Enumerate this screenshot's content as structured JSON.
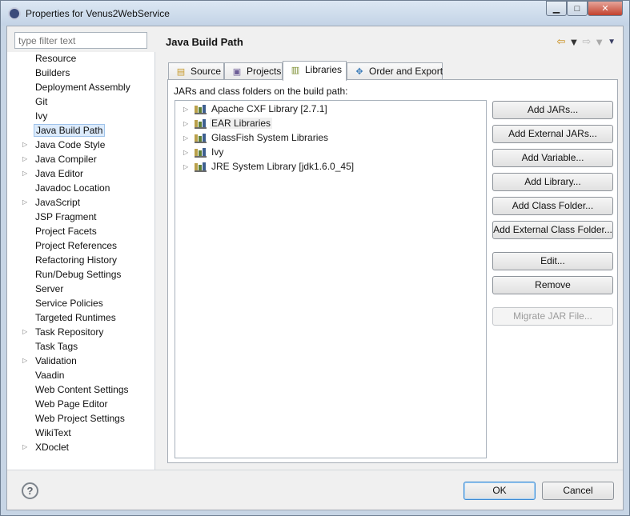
{
  "window": {
    "title": "Properties for Venus2WebService",
    "minimize": "▁",
    "maximize": "□",
    "close": "✕"
  },
  "filter": {
    "placeholder": "type filter text"
  },
  "nav": [
    {
      "label": "Resource",
      "expandable": false
    },
    {
      "label": "Builders",
      "expandable": false
    },
    {
      "label": "Deployment Assembly",
      "expandable": false
    },
    {
      "label": "Git",
      "expandable": false
    },
    {
      "label": "Ivy",
      "expandable": false
    },
    {
      "label": "Java Build Path",
      "expandable": false,
      "selected": true
    },
    {
      "label": "Java Code Style",
      "expandable": true
    },
    {
      "label": "Java Compiler",
      "expandable": true
    },
    {
      "label": "Java Editor",
      "expandable": true
    },
    {
      "label": "Javadoc Location",
      "expandable": false
    },
    {
      "label": "JavaScript",
      "expandable": true
    },
    {
      "label": "JSP Fragment",
      "expandable": false
    },
    {
      "label": "Project Facets",
      "expandable": false
    },
    {
      "label": "Project References",
      "expandable": false
    },
    {
      "label": "Refactoring History",
      "expandable": false
    },
    {
      "label": "Run/Debug Settings",
      "expandable": false
    },
    {
      "label": "Server",
      "expandable": false
    },
    {
      "label": "Service Policies",
      "expandable": false
    },
    {
      "label": "Targeted Runtimes",
      "expandable": false
    },
    {
      "label": "Task Repository",
      "expandable": true
    },
    {
      "label": "Task Tags",
      "expandable": false
    },
    {
      "label": "Validation",
      "expandable": true
    },
    {
      "label": "Vaadin",
      "expandable": false
    },
    {
      "label": "Web Content Settings",
      "expandable": false
    },
    {
      "label": "Web Page Editor",
      "expandable": false
    },
    {
      "label": "Web Project Settings",
      "expandable": false
    },
    {
      "label": "WikiText",
      "expandable": false
    },
    {
      "label": "XDoclet",
      "expandable": true
    }
  ],
  "page": {
    "title": "Java Build Path",
    "tabs": [
      {
        "label": "Source",
        "icon": "source-folder-icon"
      },
      {
        "label": "Projects",
        "icon": "projects-icon"
      },
      {
        "label": "Libraries",
        "icon": "libraries-icon",
        "active": true
      },
      {
        "label": "Order and Export",
        "icon": "order-export-icon"
      }
    ],
    "pane_label": "JARs and class folders on the build path:",
    "libraries": [
      {
        "label": "Apache CXF Library [2.7.1]"
      },
      {
        "label": "EAR Libraries",
        "highlighted": true
      },
      {
        "label": "GlassFish System Libraries"
      },
      {
        "label": "Ivy"
      },
      {
        "label": "JRE System Library [jdk1.6.0_45]"
      }
    ],
    "buttons": {
      "add_jars": "Add JARs...",
      "add_external_jars": "Add External JARs...",
      "add_variable": "Add Variable...",
      "add_library": "Add Library...",
      "add_class_folder": "Add Class Folder...",
      "add_external_class_folder": "Add External Class Folder...",
      "edit": "Edit...",
      "remove": "Remove",
      "migrate_jar": "Migrate JAR File..."
    }
  },
  "footer": {
    "help": "?",
    "ok": "OK",
    "cancel": "Cancel"
  },
  "colors": {
    "selection": "#dcebfc",
    "window_frame": "#c7d5e5",
    "back_arrow": "#c98a12"
  }
}
